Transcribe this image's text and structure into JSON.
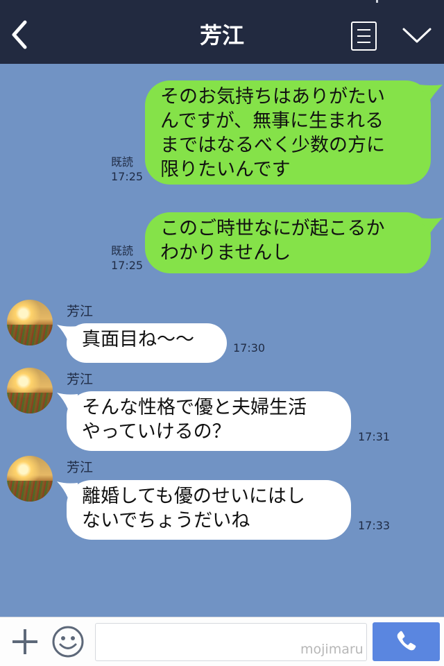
{
  "header": {
    "title": "芳江"
  },
  "messages": [
    {
      "side": "out",
      "lines": [
        "そのお気持ちはありがたい",
        "んですが、無事に生まれる",
        "まではなるべく少数の方に",
        "限りたいんです"
      ],
      "read": "既読",
      "time": "17:25"
    },
    {
      "side": "out",
      "lines": [
        "このご時世なにが起こるか",
        "わかりませんし"
      ],
      "read": "既読",
      "time": "17:25"
    },
    {
      "side": "in",
      "sender": "芳江",
      "lines": [
        "真面目ね〜〜"
      ],
      "time": "17:30"
    },
    {
      "side": "in",
      "sender": "芳江",
      "lines": [
        "そんな性格で優と夫婦生活",
        "やっていけるの？"
      ],
      "time": "17:31"
    },
    {
      "side": "in",
      "sender": "芳江",
      "lines": [
        "離婚しても優のせいにはし",
        "ないでちょうだいね"
      ],
      "time": "17:33"
    }
  ],
  "footer": {
    "input_value": "",
    "watermark": "mojimaru"
  },
  "icons": [
    "back-icon",
    "menu-icon",
    "chevron-down-icon",
    "plus-icon",
    "smiley-icon",
    "phone-icon"
  ],
  "colors": {
    "header": "#222a40",
    "background": "#7193c4",
    "outgoing_bubble": "#85e249",
    "incoming_bubble": "#ffffff",
    "call_button": "#5a86e0"
  }
}
